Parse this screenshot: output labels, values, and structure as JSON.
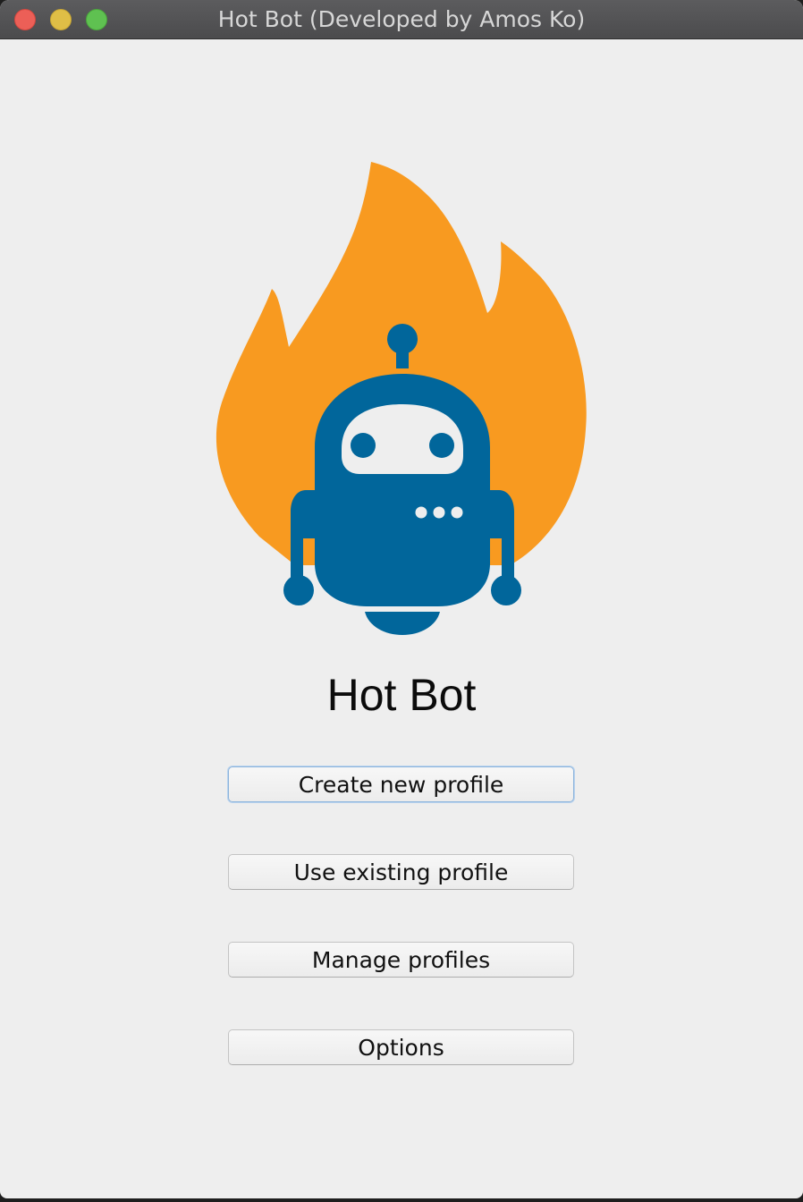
{
  "window": {
    "title": "Hot Bot (Developed by Amos Ko)"
  },
  "app": {
    "name": "Hot Bot",
    "logo": "flame-robot-logo"
  },
  "buttons": [
    {
      "label": "Create new profile"
    },
    {
      "label": "Use existing profile"
    },
    {
      "label": "Manage profiles"
    },
    {
      "label": "Options"
    }
  ],
  "colors": {
    "flame": "#f89a20",
    "robot": "#01669b",
    "background": "#eeeeee"
  }
}
